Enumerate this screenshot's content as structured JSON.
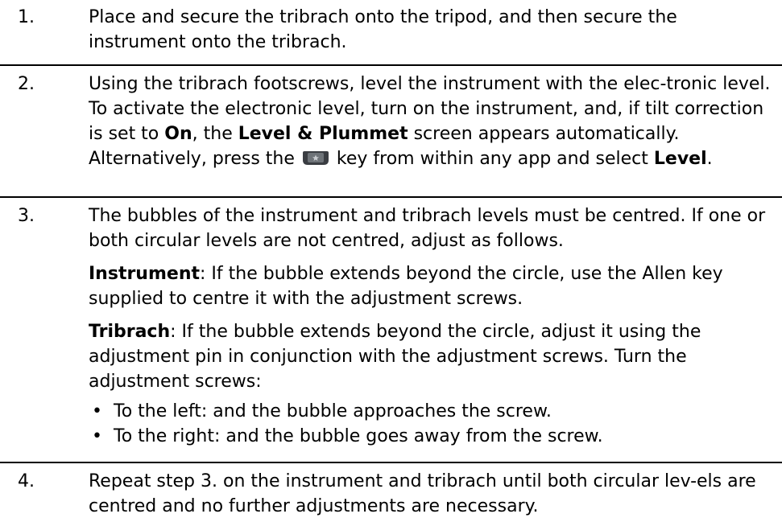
{
  "steps": [
    {
      "number": "1.",
      "text": "Place and secure the tribrach onto the tripod, and then secure the instrument onto the tribrach."
    },
    {
      "number": "2.",
      "part1": "Using the tribrach footscrews, level the instrument with the elec-tronic level. To activate the electronic level, turn on the instrument, and, if tilt correction is set to ",
      "bold_on": "On",
      "part2": ", the ",
      "bold_screen": "Level & Plummet",
      "part3": " screen appears automatically. Alternatively, press the ",
      "key_icon": "favourites-key-icon",
      "part4": " key from within any app and select ",
      "bold_level": "Level",
      "part5": "."
    },
    {
      "number": "3.",
      "intro": "The bubbles of the instrument and tribrach levels must be centred. If one or both circular levels are not centred, adjust as follows.",
      "instrument_label": "Instrument",
      "instrument_text": ": If the bubble extends beyond the circle, use the Allen key supplied to centre it with the adjustment screws.",
      "tribrach_label": "Tribrach",
      "tribrach_text": ": If the bubble extends beyond the circle, adjust it using the adjustment pin in conjunction with the adjustment screws. Turn the adjustment screws:",
      "bullet_symbol": "•",
      "bullets": [
        "To the left: and the bubble approaches the screw.",
        "To the right: and the bubble goes away from the screw."
      ]
    },
    {
      "number": "4.",
      "text": "Repeat step 3. on the instrument and tribrach until both circular lev-els are centred and no further adjustments are necessary."
    }
  ],
  "colors": {
    "text": "#000000",
    "rule": "#000000",
    "key_icon_body": "#3a3d42",
    "key_icon_face": "#6e7378"
  }
}
